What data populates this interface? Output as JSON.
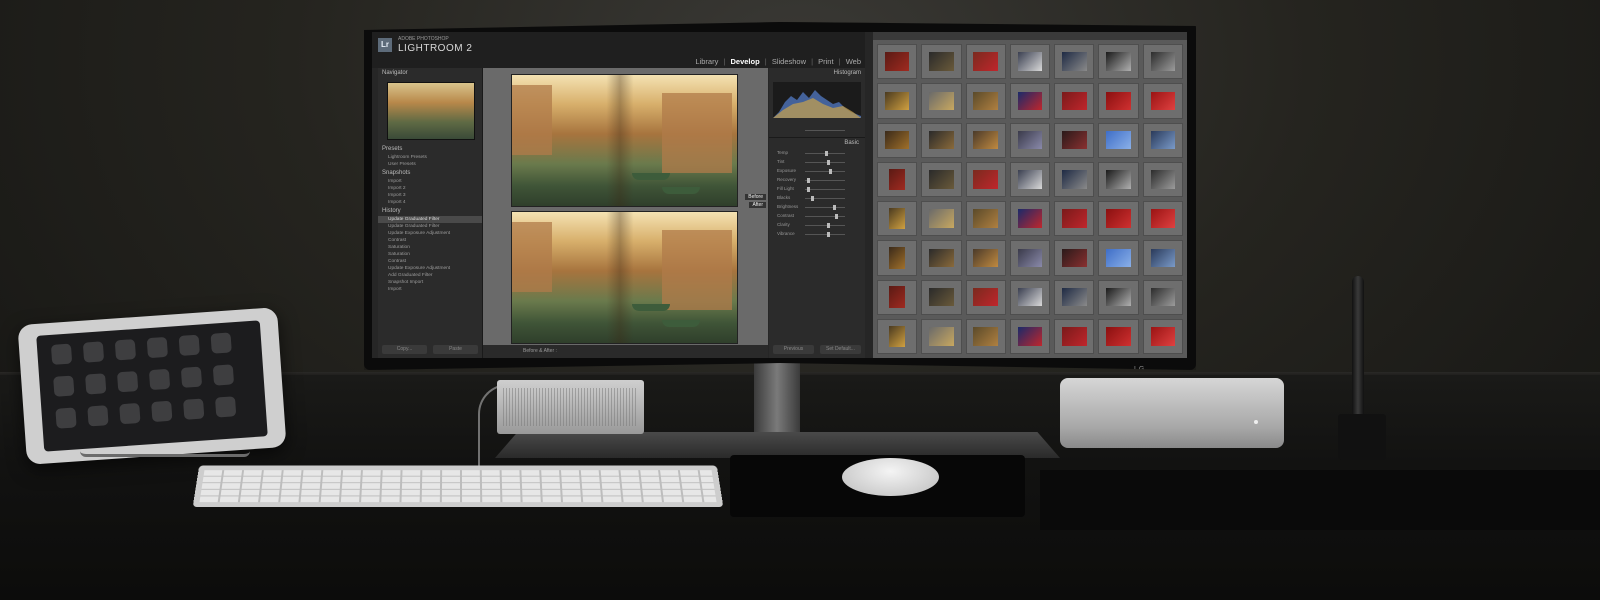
{
  "lightroom": {
    "badge": "Lr",
    "vendor": "ADOBE PHOTOSHOP",
    "name": "LIGHTROOM 2",
    "modules": [
      "Library",
      "Develop",
      "Slideshow",
      "Print",
      "Web"
    ],
    "active_module": "Develop",
    "left_panel": {
      "navigator": "Navigator",
      "presets": "Presets",
      "presets_items": [
        "Lightroom Presets",
        "User Presets"
      ],
      "snapshots": "Snapshots",
      "snapshots_items": [
        "Import",
        "Import 2",
        "Import 3",
        "Import 4"
      ],
      "history": "History",
      "history_items": [
        "Update Graduated Filter",
        "Update Graduated Filter",
        "Update Exposure Adjustment",
        "Contrast",
        "Saturation",
        "Saturation",
        "Contrast",
        "Update Exposure Adjustment",
        "Add Graduated Filter",
        "Snapshot Import",
        "Import"
      ],
      "copy_label": "Copy...",
      "paste_label": "Paste"
    },
    "center": {
      "before_label": "Before",
      "after_label": "After",
      "toolbar_label": "Before & After :"
    },
    "right_panel": {
      "histogram": "Histogram",
      "basic": "Basic",
      "sliders": [
        "Temp",
        "Tint",
        "Exposure",
        "Recovery",
        "Fill Light",
        "Blacks",
        "Brightness",
        "Contrast",
        "Clarity",
        "Vibrance"
      ],
      "previous_label": "Previous",
      "reset_label": "Set Default..."
    }
  },
  "monitor": {
    "brand": "LG"
  },
  "colors": {
    "lightroom_panel": "#2b2b2b",
    "grid_background": "#5a5a5a",
    "accent_blue": "#3f6ec7",
    "accent_red": "#c0262c"
  }
}
